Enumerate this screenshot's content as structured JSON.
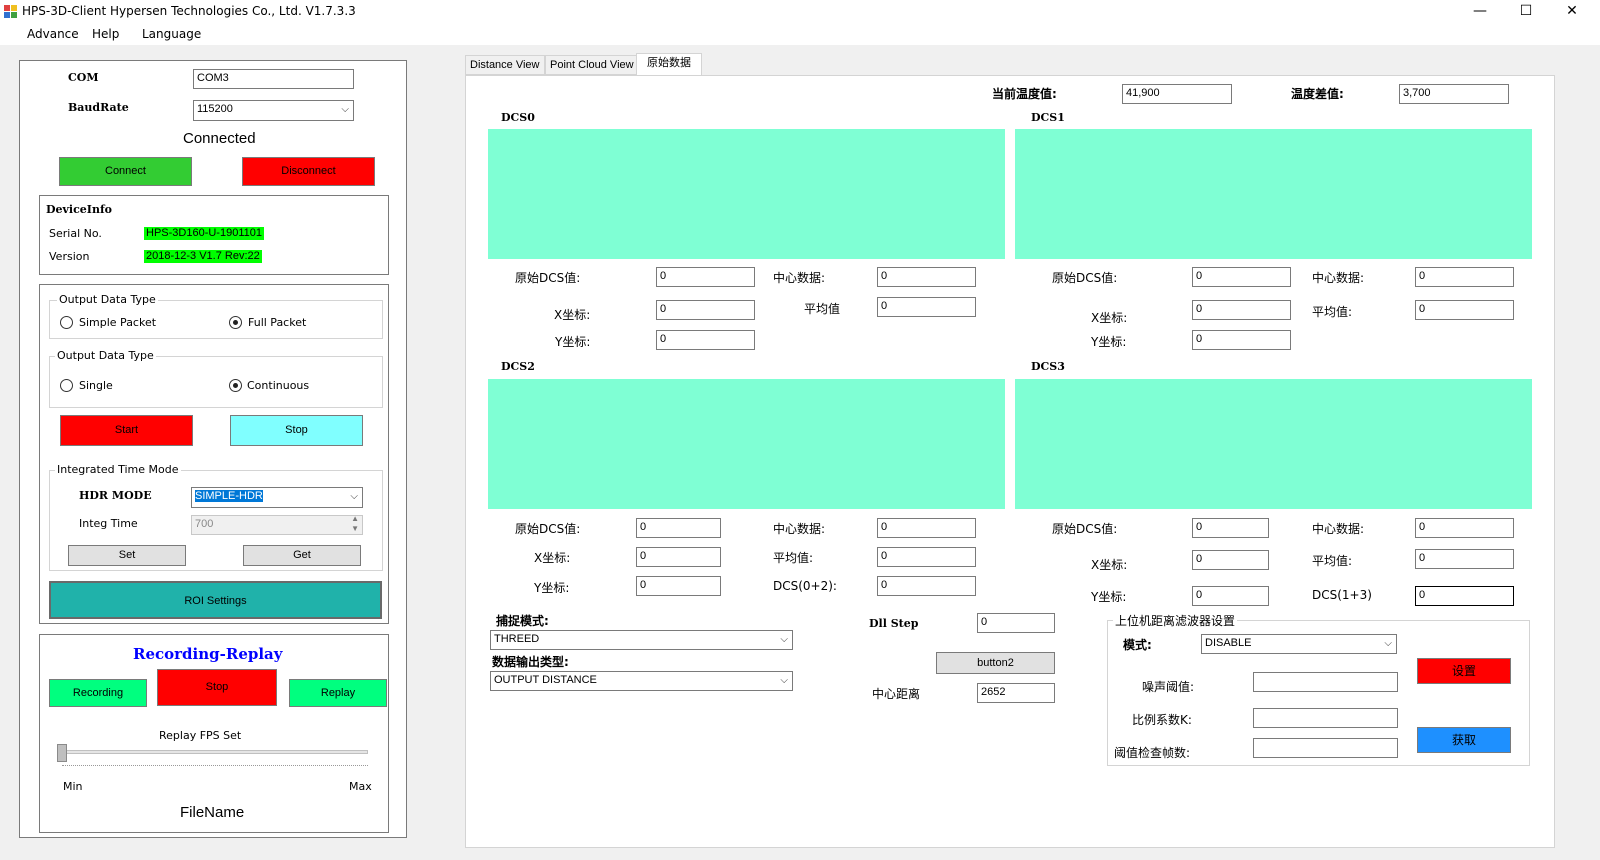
{
  "window": {
    "title": "HPS-3D-Client  Hypersen Technologies Co., Ltd.   V1.7.3.3",
    "minimize": "—",
    "maximize": "☐",
    "close": "✕"
  },
  "menu": [
    "Advance",
    "Help",
    "Language"
  ],
  "connection": {
    "com_label": "COM",
    "com_value": "COM3",
    "baud_label": "BaudRate",
    "baud_value": "115200",
    "status": "Connected",
    "connect_label": "Connect",
    "disconnect_label": "Disconnect"
  },
  "device_info": {
    "title": "DeviceInfo",
    "serial_label": "Serial No.",
    "serial_value": "HPS-3D160-U-1901101",
    "version_label": "Version",
    "version_value": "2018-12-3  V1.7 Rev:22"
  },
  "output": {
    "group1_title": "Output Data Type",
    "simple_packet": "Simple Packet",
    "full_packet": "Full Packet",
    "group2_title": "Output Data Type",
    "single": "Single",
    "continuous": "Continuous",
    "start_label": "Start",
    "stop_label": "Stop"
  },
  "integ": {
    "title": "Integrated Time Mode",
    "hdr_label": "HDR MODE",
    "hdr_value": "SIMPLE-HDR",
    "integ_label": "Integ Time",
    "integ_value": "700",
    "set_label": "Set",
    "get_label": "Get"
  },
  "roi_label": "ROI Settings",
  "recording": {
    "title": "Recording-Replay",
    "recording_label": "Recording",
    "stop_label": "Stop",
    "replay_label": "Replay",
    "fps_label": "Replay FPS Set",
    "min_label": "Min",
    "max_label": "Max",
    "filename_label": "FileName"
  },
  "tabs": [
    "Distance View",
    "Point Cloud View",
    "原始数据"
  ],
  "temperature": {
    "current_label": "当前温度值:",
    "current_value": "41,900",
    "diff_label": "温度差值:",
    "diff_value": "3,700"
  },
  "dcs": [
    {
      "title": "DCS0",
      "raw_label": "原始DCS值:",
      "raw_value": "0",
      "center_label": "中心数据:",
      "center_value": "0",
      "x_label": "X坐标:",
      "x_value": "0",
      "avg_label": "平均值",
      "avg_value": "0",
      "y_label": "Y坐标:",
      "y_value": "0"
    },
    {
      "title": "DCS1",
      "raw_label": "原始DCS值:",
      "raw_value": "0",
      "center_label": "中心数据:",
      "center_value": "0",
      "x_label": "X坐标:",
      "x_value": "0",
      "avg_label": "平均值:",
      "avg_value": "0",
      "y_label": "Y坐标:",
      "y_value": "0"
    },
    {
      "title": "DCS2",
      "raw_label": "原始DCS值:",
      "raw_value": "0",
      "center_label": "中心数据:",
      "center_value": "0",
      "x_label": "X坐标:",
      "x_value": "0",
      "avg_label": "平均值:",
      "avg_value": "0",
      "y_label": "Y坐标:",
      "y_value": "0",
      "sum_label": "DCS(0+2):",
      "sum_value": "0"
    },
    {
      "title": "DCS3",
      "raw_label": "原始DCS值:",
      "raw_value": "0",
      "center_label": "中心数据:",
      "center_value": "0",
      "x_label": "X坐标:",
      "x_value": "0",
      "avg_label": "平均值:",
      "avg_value": "0",
      "y_label": "Y坐标:",
      "y_value": "0",
      "sum_label": "DCS(1+3)",
      "sum_value": "0"
    }
  ],
  "capture": {
    "mode_label": "捕捉模式:",
    "mode_value": "THREED",
    "output_label": "数据输出类型:",
    "output_value": "OUTPUT DISTANCE"
  },
  "dll": {
    "step_label": "Dll Step",
    "step_value": "0",
    "button2_label": "button2",
    "center_dist_label": "中心距离",
    "center_dist_value": "2652"
  },
  "filter": {
    "title": "上位机距离滤波器设置",
    "mode_label": "模式:",
    "mode_value": "DISABLE",
    "noise_label": "噪声阈值:",
    "noise_value": "",
    "ratio_label": "比例系数K:",
    "ratio_value": "",
    "frames_label": "阈值检查帧数:",
    "frames_value": "",
    "set_label": "设置",
    "get_label": "获取"
  },
  "colors": {
    "green_button": "#33cc33",
    "red_button": "#ff0000",
    "cyan_button": "#80ffff",
    "teal_button": "#20b2aa",
    "recording_green": "#00ff7f",
    "blue_button": "#1e90ff",
    "dcs_area": "#7fffd4",
    "highlight": "#00ff00",
    "recording_title": "#0000ff"
  }
}
